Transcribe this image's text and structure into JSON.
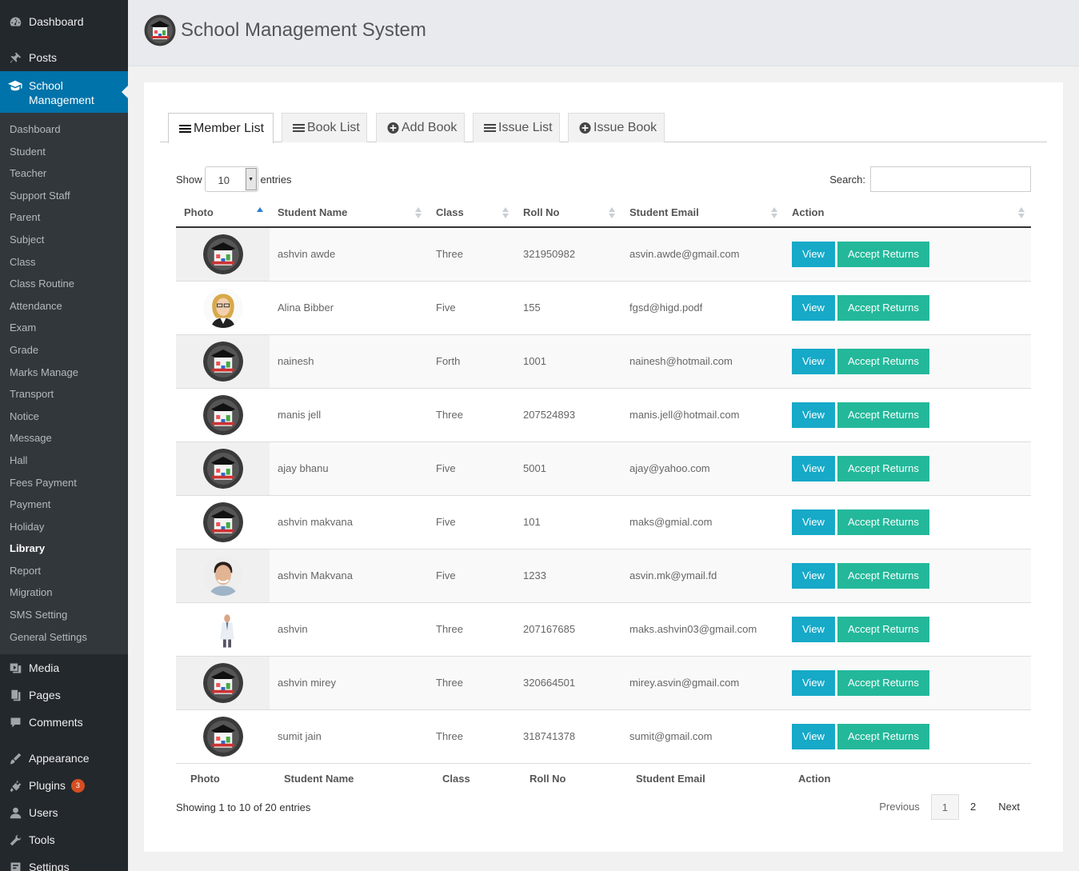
{
  "sidebar": {
    "top_items": [
      {
        "label": "Dashboard",
        "icon": "dashboard-icon"
      },
      {
        "label": "Posts",
        "icon": "pin-icon"
      }
    ],
    "active_item": {
      "label": "School Management",
      "icon": "graduation-cap-icon"
    },
    "submenu": [
      "Dashboard",
      "Student",
      "Teacher",
      "Support Staff",
      "Parent",
      "Subject",
      "Class",
      "Class Routine",
      "Attendance",
      "Exam",
      "Grade",
      "Marks Manage",
      "Transport",
      "Notice",
      "Message",
      "Hall",
      "Fees Payment",
      "Payment",
      "Holiday",
      "Library",
      "Report",
      "Migration",
      "SMS Setting",
      "General Settings"
    ],
    "current_submenu": "Library",
    "bottom_items": [
      {
        "label": "Media",
        "icon": "media-icon"
      },
      {
        "label": "Pages",
        "icon": "pages-icon"
      },
      {
        "label": "Comments",
        "icon": "comments-icon"
      },
      {
        "label": "Appearance",
        "icon": "appearance-icon"
      },
      {
        "label": "Plugins",
        "icon": "plugins-icon",
        "badge": "3"
      },
      {
        "label": "Users",
        "icon": "users-icon"
      },
      {
        "label": "Tools",
        "icon": "tools-icon"
      },
      {
        "label": "Settings",
        "icon": "settings-icon"
      }
    ]
  },
  "header": {
    "title": "School Management System"
  },
  "tabs": [
    {
      "label": "Member List",
      "icon": "list-icon",
      "active": true
    },
    {
      "label": "Book List",
      "icon": "list-icon",
      "active": false
    },
    {
      "label": "Add Book",
      "icon": "plus-circle-icon",
      "active": false
    },
    {
      "label": "Issue List",
      "icon": "list-icon",
      "active": false
    },
    {
      "label": "Issue Book",
      "icon": "plus-circle-icon",
      "active": false
    }
  ],
  "controls": {
    "show_label": "Show",
    "entries_value": "10",
    "entries_label": "entries",
    "search_label": "Search:",
    "search_value": ""
  },
  "table": {
    "columns": [
      "Photo",
      "Student Name",
      "Class",
      "Roll No",
      "Student Email",
      "Action"
    ],
    "rows": [
      {
        "photo": "school-logo",
        "name": "ashvin awde",
        "class": "Three",
        "roll": "321950982",
        "email": "asvin.awde@gmail.com"
      },
      {
        "photo": "woman-photo",
        "name": "Alina Bibber",
        "class": "Five",
        "roll": "155",
        "email": "fgsd@higd.podf"
      },
      {
        "photo": "school-logo",
        "name": "nainesh",
        "class": "Forth",
        "roll": "1001",
        "email": "nainesh@hotmail.com"
      },
      {
        "photo": "school-logo",
        "name": "manis jell",
        "class": "Three",
        "roll": "207524893",
        "email": "manis.jell@hotmail.com"
      },
      {
        "photo": "school-logo",
        "name": "ajay bhanu",
        "class": "Five",
        "roll": "5001",
        "email": "ajay@yahoo.com"
      },
      {
        "photo": "school-logo",
        "name": "ashvin makvana",
        "class": "Five",
        "roll": "101",
        "email": "maks@gmial.com"
      },
      {
        "photo": "man-photo",
        "name": "ashvin Makvana",
        "class": "Five",
        "roll": "1233",
        "email": "asvin.mk@ymail.fd"
      },
      {
        "photo": "doctor-photo",
        "name": "ashvin",
        "class": "Three",
        "roll": "207167685",
        "email": "maks.ashvin03@gmail.com"
      },
      {
        "photo": "school-logo",
        "name": "ashvin mirey",
        "class": "Three",
        "roll": "320664501",
        "email": "mirey.asvin@gmail.com"
      },
      {
        "photo": "school-logo",
        "name": "sumit jain",
        "class": "Three",
        "roll": "318741378",
        "email": "sumit@gmail.com"
      }
    ],
    "view_label": "View",
    "accept_label": "Accept Returns"
  },
  "footer": {
    "info": "Showing 1 to 10 of 20 entries",
    "pagination": {
      "previous": "Previous",
      "pages": [
        "1",
        "2"
      ],
      "current": "1",
      "next": "Next"
    }
  },
  "colors": {
    "view_button": "#16a9c8",
    "accept_button": "#23b89a",
    "sidebar_active": "#0073aa",
    "sidebar_bg": "#23282d"
  }
}
